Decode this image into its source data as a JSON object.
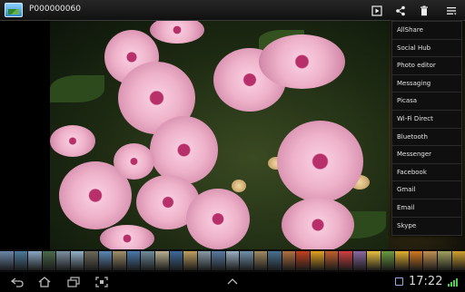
{
  "actionbar": {
    "title": "P000000060",
    "icons": [
      "gallery-app-icon",
      "slideshow-icon",
      "share-icon",
      "delete-icon",
      "overflow-menu-icon"
    ]
  },
  "menu": {
    "items": [
      {
        "label": "AllShare"
      },
      {
        "label": "Social Hub"
      },
      {
        "label": "Photo editor"
      },
      {
        "label": "Messaging"
      },
      {
        "label": "Picasa"
      },
      {
        "label": "Wi-Fi Direct"
      },
      {
        "label": "Bluetooth"
      },
      {
        "label": "Messenger"
      },
      {
        "label": "Facebook"
      },
      {
        "label": "Gmail"
      },
      {
        "label": "Email"
      },
      {
        "label": "Skype"
      }
    ]
  },
  "filmstrip": {
    "thumb_colors": [
      "#6a87a8",
      "#4d7a9a",
      "#8aa6c2",
      "#4a6a4a",
      "#7c8fa0",
      "#93b1c8",
      "#6d6a5a",
      "#5b87b4",
      "#a0906a",
      "#4a78a8",
      "#6f8c9c",
      "#b8b090",
      "#3e6a9a",
      "#c0a060",
      "#8a9aa8",
      "#5a7aa0",
      "#9cb0c4",
      "#7090a8",
      "#a08a60",
      "#4a7090",
      "#b07040",
      "#c04020",
      "#e0a020",
      "#c06030",
      "#d04040",
      "#8a6aa0",
      "#e8c040",
      "#6a9a40",
      "#e0b030",
      "#d07820",
      "#c09050",
      "#a0a060",
      "#d0a030"
    ]
  },
  "sysbar": {
    "time": "17:22",
    "icons": [
      "back-icon",
      "home-icon",
      "recent-apps-icon",
      "screenshot-icon",
      "up-arrow-icon",
      "notification-icon",
      "signal-icon"
    ]
  }
}
